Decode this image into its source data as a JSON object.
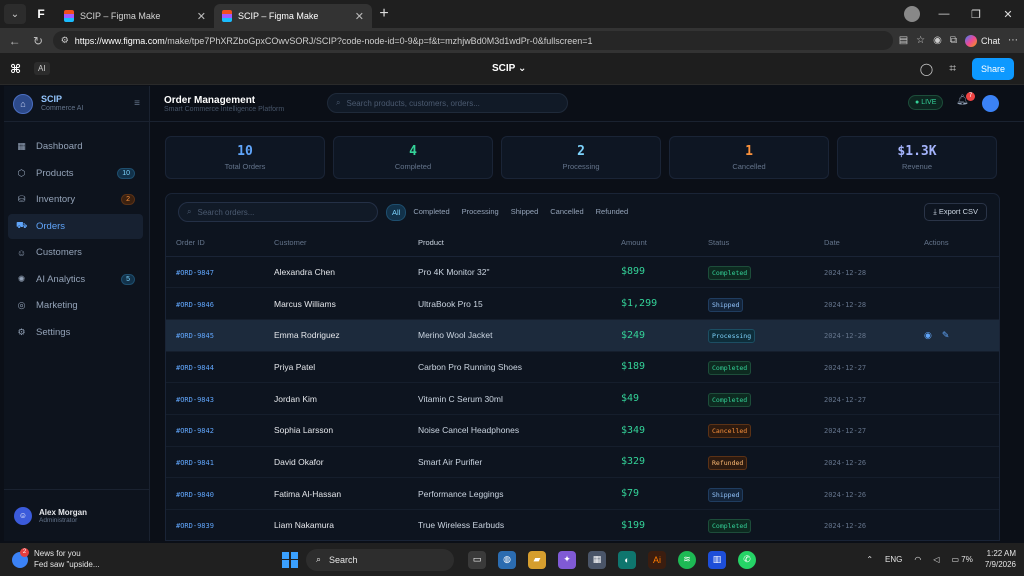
{
  "browser": {
    "tabs": [
      {
        "title": "SCIP – Figma Make"
      },
      {
        "title": "SCIP – Figma Make"
      }
    ],
    "url_host": "https://www.figma.com",
    "url_path": "/make/tpe7PhXRZboGpxCOwvSORJ/SCIP?code-node-id=0-9&p=f&t=mzhjwBd0M3d1wdPr-0&fullscreen=1",
    "chat_label": "Chat"
  },
  "figma": {
    "ai_label": "AI",
    "project_title": "SCIP",
    "share_label": "Share"
  },
  "app": {
    "brand_name": "SCIP",
    "brand_sub": "Commerce AI",
    "nav": [
      {
        "label": "Dashboard",
        "icon": "grid-icon"
      },
      {
        "label": "Products",
        "icon": "box-icon",
        "badge": "10"
      },
      {
        "label": "Inventory",
        "icon": "warehouse-icon",
        "badge": "2"
      },
      {
        "label": "Orders",
        "icon": "cart-icon"
      },
      {
        "label": "Customers",
        "icon": "users-icon"
      },
      {
        "label": "AI Analytics",
        "icon": "brain-icon",
        "badge": "5"
      },
      {
        "label": "Marketing",
        "icon": "megaphone-icon"
      },
      {
        "label": "Settings",
        "icon": "gear-icon"
      }
    ],
    "user": {
      "name": "Alex Morgan",
      "role": "Administrator"
    },
    "page_title": "Order Management",
    "page_sub": "Smart Commerce Intelligence Platform",
    "search_placeholder": "Search products, customers, orders...",
    "live_label": "LIVE",
    "notif_count": "7",
    "stats": [
      {
        "value": "10",
        "label": "Total Orders",
        "color": "#60a5fa"
      },
      {
        "value": "4",
        "label": "Completed",
        "color": "#34d399"
      },
      {
        "value": "2",
        "label": "Processing",
        "color": "#7dd3fc"
      },
      {
        "value": "1",
        "label": "Cancelled",
        "color": "#fb923c"
      },
      {
        "value": "$1.3K",
        "label": "Revenue",
        "color": "#a5b4fc"
      }
    ],
    "order_search_placeholder": "Search orders...",
    "filters": [
      "All",
      "Completed",
      "Processing",
      "Shipped",
      "Cancelled",
      "Refunded"
    ],
    "export_label": "Export CSV",
    "columns": [
      "Order ID",
      "Customer",
      "Product",
      "Amount",
      "Status",
      "Date",
      "Actions"
    ],
    "orders": [
      {
        "id": "#ORD-9847",
        "customer": "Alexandra Chen",
        "product": "Pro 4K Monitor 32\"",
        "amount": "$899",
        "status": "Completed",
        "date": "2024-12-28"
      },
      {
        "id": "#ORD-9846",
        "customer": "Marcus Williams",
        "product": "UltraBook Pro 15",
        "amount": "$1,299",
        "status": "Shipped",
        "date": "2024-12-28"
      },
      {
        "id": "#ORD-9845",
        "customer": "Emma Rodriguez",
        "product": "Merino Wool Jacket",
        "amount": "$249",
        "status": "Processing",
        "date": "2024-12-28"
      },
      {
        "id": "#ORD-9844",
        "customer": "Priya Patel",
        "product": "Carbon Pro Running Shoes",
        "amount": "$189",
        "status": "Completed",
        "date": "2024-12-27"
      },
      {
        "id": "#ORD-9843",
        "customer": "Jordan Kim",
        "product": "Vitamin C Serum 30ml",
        "amount": "$49",
        "status": "Completed",
        "date": "2024-12-27"
      },
      {
        "id": "#ORD-9842",
        "customer": "Sophia Larsson",
        "product": "Noise Cancel Headphones",
        "amount": "$349",
        "status": "Cancelled",
        "date": "2024-12-27"
      },
      {
        "id": "#ORD-9841",
        "customer": "David Okafor",
        "product": "Smart Air Purifier",
        "amount": "$329",
        "status": "Refunded",
        "date": "2024-12-26"
      },
      {
        "id": "#ORD-9840",
        "customer": "Fatima Al-Hassan",
        "product": "Performance Leggings",
        "amount": "$79",
        "status": "Shipped",
        "date": "2024-12-26"
      },
      {
        "id": "#ORD-9839",
        "customer": "Liam Nakamura",
        "product": "True Wireless Earbuds",
        "amount": "$199",
        "status": "Completed",
        "date": "2024-12-26"
      }
    ]
  },
  "taskbar": {
    "news_title": "News for you",
    "news_sub": "Fed saw \"upside...",
    "news_count": "2",
    "search_label": "Search",
    "lang": "ENG",
    "battery": "7%",
    "time": "1:22 AM",
    "date": "7/9/2026"
  }
}
